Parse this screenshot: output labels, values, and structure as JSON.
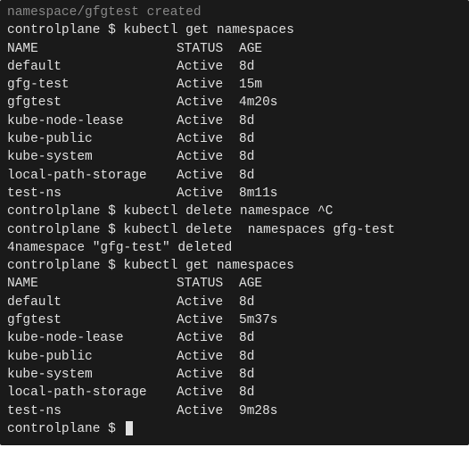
{
  "top_faded": "namespace/gfgtest created",
  "prompt_host": "controlplane",
  "prompt_symbol": "$",
  "cmd1": "kubectl get namespaces",
  "table1": {
    "headers": {
      "name": "NAME",
      "status": "STATUS",
      "age": "AGE"
    },
    "rows": [
      {
        "name": "default",
        "status": "Active",
        "age": "8d"
      },
      {
        "name": "gfg-test",
        "status": "Active",
        "age": "15m"
      },
      {
        "name": "gfgtest",
        "status": "Active",
        "age": "4m20s"
      },
      {
        "name": "kube-node-lease",
        "status": "Active",
        "age": "8d"
      },
      {
        "name": "kube-public",
        "status": "Active",
        "age": "8d"
      },
      {
        "name": "kube-system",
        "status": "Active",
        "age": "8d"
      },
      {
        "name": "local-path-storage",
        "status": "Active",
        "age": "8d"
      },
      {
        "name": "test-ns",
        "status": "Active",
        "age": "8m11s"
      }
    ]
  },
  "cmd2": "kubectl delete namespace ^C",
  "cmd3": "kubectl delete  namespaces gfg-test",
  "output3": "4namespace \"gfg-test\" deleted",
  "cmd4": "kubectl get namespaces",
  "table2": {
    "headers": {
      "name": "NAME",
      "status": "STATUS",
      "age": "AGE"
    },
    "rows": [
      {
        "name": "default",
        "status": "Active",
        "age": "8d"
      },
      {
        "name": "gfgtest",
        "status": "Active",
        "age": "5m37s"
      },
      {
        "name": "kube-node-lease",
        "status": "Active",
        "age": "8d"
      },
      {
        "name": "kube-public",
        "status": "Active",
        "age": "8d"
      },
      {
        "name": "kube-system",
        "status": "Active",
        "age": "8d"
      },
      {
        "name": "local-path-storage",
        "status": "Active",
        "age": "8d"
      },
      {
        "name": "test-ns",
        "status": "Active",
        "age": "9m28s"
      }
    ]
  }
}
